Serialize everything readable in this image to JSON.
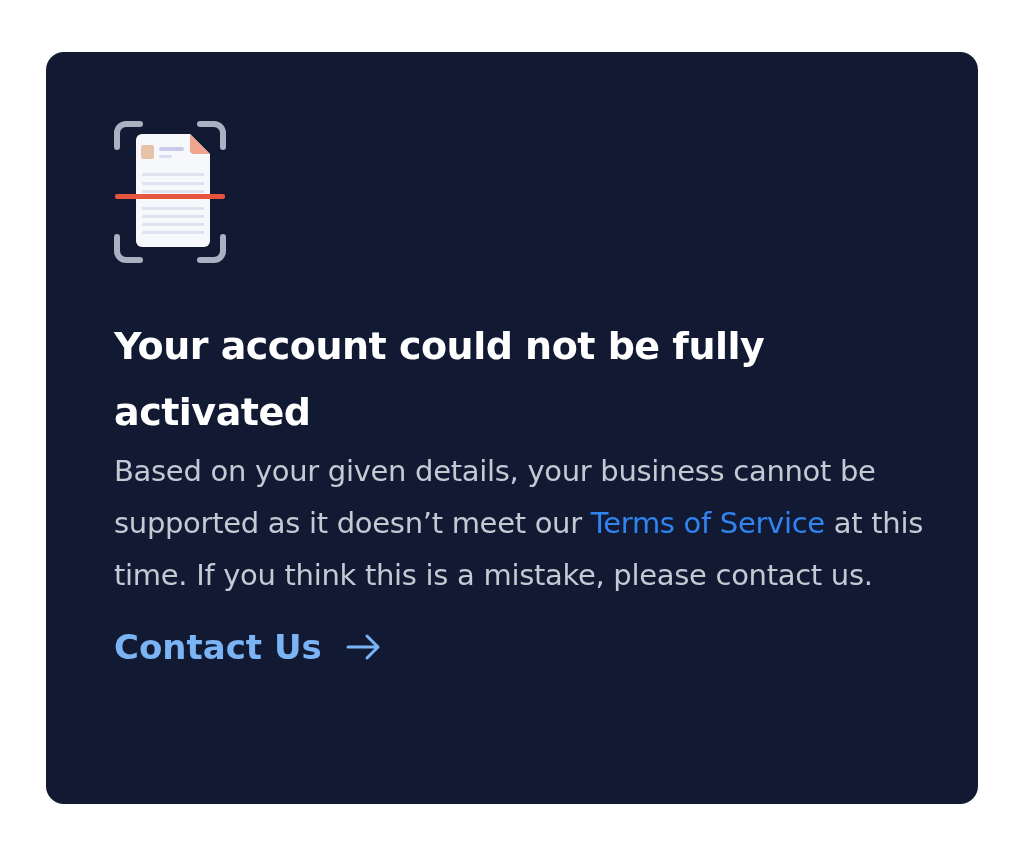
{
  "card": {
    "title": "Your account could not be fully activated",
    "message": {
      "before": "Based on your given details, your business cannot be supported as it doesn’t meet our",
      "link": "Terms of Service",
      "after": "at this time. If you think this is a mistake, please contact us."
    },
    "action": "Contact Us"
  }
}
